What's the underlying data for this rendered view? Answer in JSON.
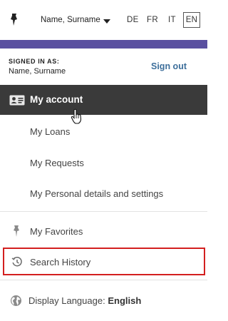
{
  "header": {
    "user_name": "Name, Surname",
    "languages": [
      "DE",
      "FR",
      "IT",
      "EN"
    ],
    "active_language": "EN"
  },
  "signed_in": {
    "label": "SIGNED IN AS:",
    "name": "Name, Surname",
    "sign_out": "Sign out"
  },
  "menu": {
    "account": "My account",
    "loans": "My Loans",
    "requests": "My Requests",
    "personal": "My Personal details and settings",
    "favorites": "My Favorites",
    "search_history": "Search History",
    "display_language_label": "Display Language:",
    "display_language_value": "English"
  },
  "colors": {
    "accent_bar": "#5a50a0",
    "account_bg": "#3a3a3a",
    "highlight_border": "#d31f1f",
    "link": "#3d6f9b"
  },
  "icons": {
    "top_pin": "pin-icon",
    "user_dropdown": "chevron-down-icon",
    "account": "id-card-icon",
    "cursor": "hand-pointer-icon",
    "favorites": "pin-icon",
    "history": "history-icon",
    "display_language": "globe-icon"
  }
}
